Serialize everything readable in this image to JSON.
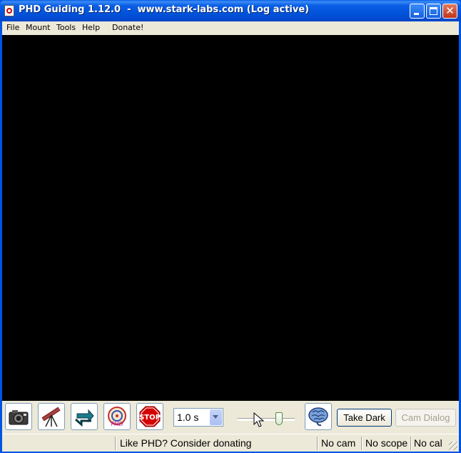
{
  "window": {
    "title": "PHD Guiding 1.12.0  -  www.stark-labs.com (Log active)"
  },
  "menu": {
    "file": "File",
    "mount": "Mount",
    "tools": "Tools",
    "help": "Help",
    "donate": "Donate!"
  },
  "toolbar": {
    "exposure_value": "1.0 s",
    "slider_level": 0.75,
    "take_dark_label": "Take Dark",
    "cam_dialog_label": "Cam Dialog",
    "icons": [
      "camera-icon",
      "telescope-icon",
      "loop-icon",
      "phd-guide-icon",
      "stop-icon",
      "brain-icon"
    ]
  },
  "status": {
    "message": "Like PHD? Consider donating",
    "camera": "No cam",
    "scope": "No scope",
    "calibration": "No cal"
  },
  "colors": {
    "titlebar": "#0054e3",
    "canvas": "#000000",
    "chrome": "#ece9d8",
    "stop": "#d40000"
  }
}
